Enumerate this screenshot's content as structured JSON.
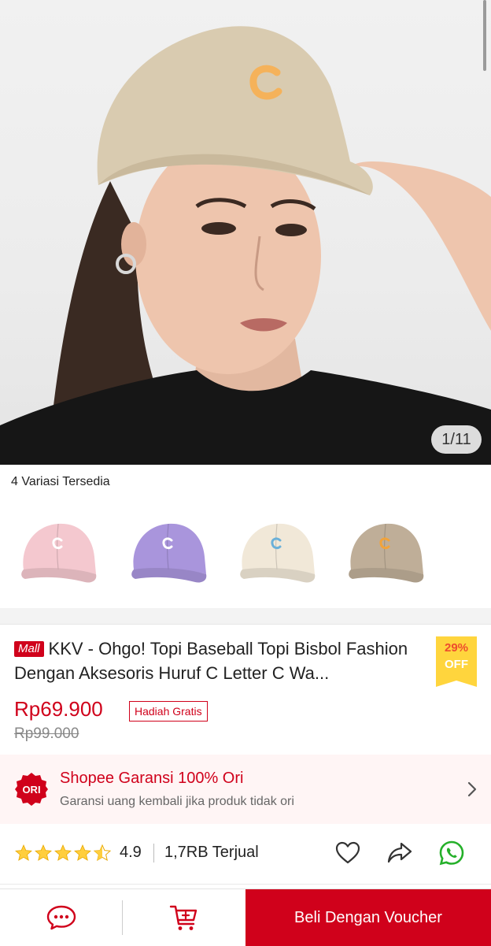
{
  "hero": {
    "image_counter": "1/11",
    "image_alt": "product-photo"
  },
  "variations": {
    "label": "4 Variasi Tersedia",
    "items": [
      {
        "name": "pink",
        "color": "#f4c8cf",
        "letter_color": "#ffffff"
      },
      {
        "name": "purple",
        "color": "#a995dc",
        "letter_color": "#ffffff"
      },
      {
        "name": "cream",
        "color": "#f1e8d8",
        "letter_color": "#6ab0d9"
      },
      {
        "name": "khaki",
        "color": "#bfae98",
        "letter_color": "#f2a33a"
      }
    ]
  },
  "product": {
    "mall_badge": "Mall",
    "title": "KKV - Ohgo! Topi Baseball Topi Bisbol Fashion Dengan Aksesoris Huruf C Letter C Wa...",
    "discount_pct": "29%",
    "discount_off": "OFF",
    "price": "Rp69.900",
    "gift_tag": "Hadiah Gratis",
    "old_price": "Rp99.000"
  },
  "guarantee": {
    "badge": "ORI",
    "title": "Shopee Garansi 100% Ori",
    "subtitle": "Garansi uang kembali jika produk tidak ori"
  },
  "rating": {
    "value": "4.9",
    "stars": 4.5,
    "sold": "1,7RB Terjual"
  },
  "bottom_bar": {
    "buy_label": "Beli Dengan Voucher"
  },
  "colors": {
    "brand_red": "#d0011b",
    "star_yellow": "#ffce3d",
    "whatsapp_green": "#25b02a"
  }
}
